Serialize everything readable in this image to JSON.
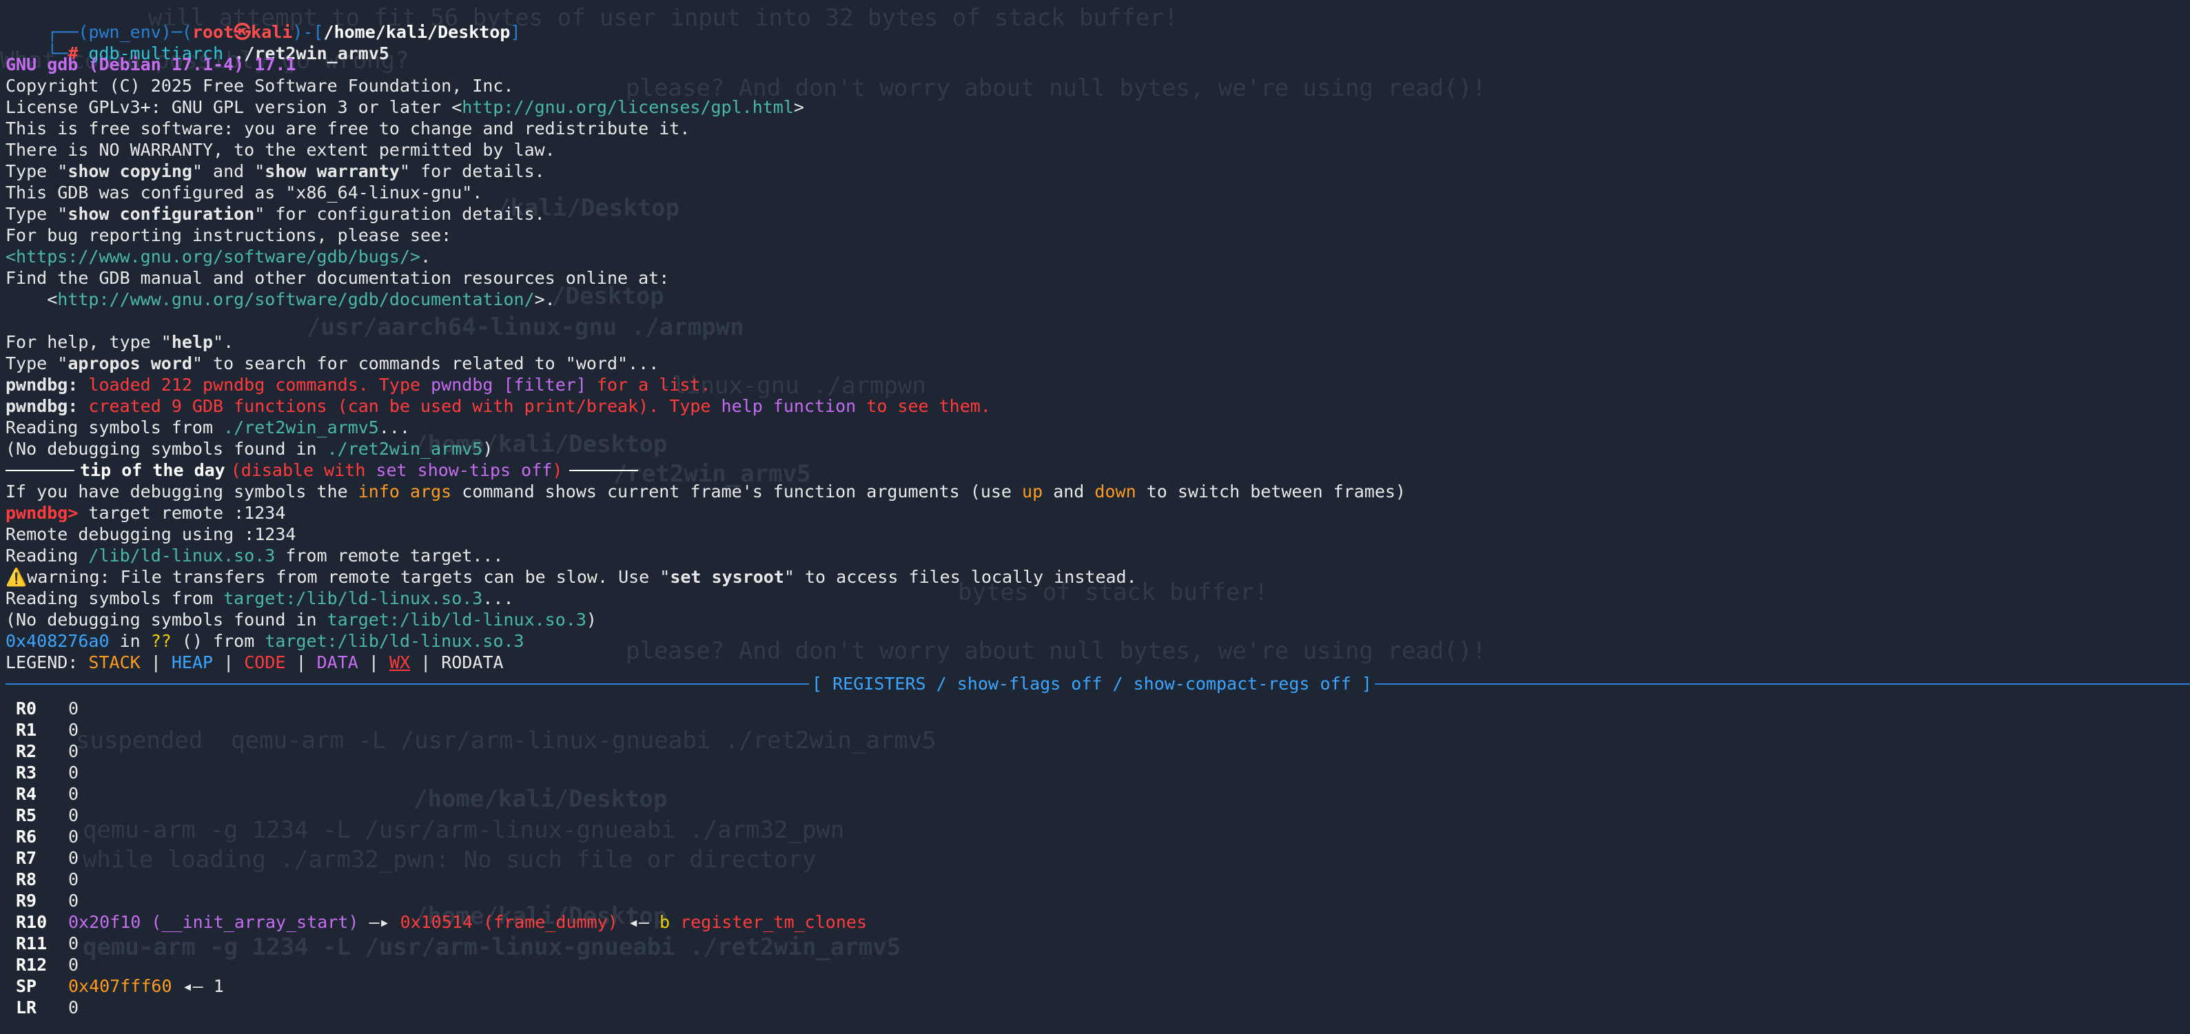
{
  "terminal": {
    "prompt": {
      "frame_open": "┌──(",
      "env": "pwn_env",
      "frame_mid": ")─(",
      "user": "root㉿kali",
      "frame_mid2": ")-[",
      "path": "/home/kali/Desktop",
      "frame_close": "]",
      "line2_frame": "└─",
      "hash": "#",
      "command_name": "gdb-multiarch",
      "command_args": " ./ret2win_armv5"
    },
    "banner": {
      "gdb_version": "GNU gdb (Debian 17.1-4) 17.1",
      "copyright": "Copyright (C) 2025 Free Software Foundation, Inc.",
      "license_prefix": "License GPLv3+: GNU GPL version 3 or later <",
      "license_url": "http://gnu.org/licenses/gpl.html",
      "license_suffix": ">",
      "free_software": "This is free software: you are free to change and redistribute it.",
      "no_warranty": "There is NO WARRANTY, to the extent permitted by law.",
      "type_prefix": "Type \"",
      "show_copying": "show copying",
      "and_mid": "\" and \"",
      "show_warranty": "show warranty",
      "details_suffix": "\" for details.",
      "configured": "This GDB was configured as \"x86_64-linux-gnu\".",
      "show_configuration": "show configuration",
      "config_suffix": "\" for configuration details.",
      "bug_reporting": "For bug reporting instructions, please see:",
      "bug_url": "<https://www.gnu.org/software/gdb/bugs/>",
      "bug_suffix": ".",
      "manual": "Find the GDB manual and other documentation resources online at:",
      "doc_prefix": "    <",
      "doc_url": "http://www.gnu.org/software/gdb/documentation/",
      "doc_suffix": ">.",
      "help_prefix": "For help, type \"",
      "help": "help",
      "help_suffix": "\".",
      "apropos_prefix": "Type \"",
      "apropos": "apropos word",
      "apropos_suffix": "\" to search for commands related to \"word\"..."
    },
    "pwndbg": {
      "label": "pwndbg:",
      "loaded_prefix": " loaded 212 pwndbg commands. Type ",
      "loaded_cmd": "pwndbg [filter]",
      "loaded_suffix": " for a list.",
      "created_prefix": " created 9 GDB functions (can be used with print/break). Type ",
      "created_cmd": "help function",
      "created_suffix": " to see them."
    },
    "symbols": {
      "reading_prefix": "Reading symbols from ",
      "reading_file": "./ret2win_armv5",
      "reading_suffix": "...",
      "nodebug_prefix": "(No debugging symbols found in ",
      "nodebug_file": "./ret2win_armv5",
      "nodebug_suffix": ")"
    },
    "tip": {
      "title": "tip of the day",
      "disable_prefix": "(disable with ",
      "disable_cmd": "set show-tips off",
      "disable_suffix": ")",
      "text_prefix": "If you have debugging symbols the ",
      "text_cmd": "info args",
      "text_mid": " command shows current frame's function arguments (use ",
      "text_up": "up",
      "text_and": " and ",
      "text_down": "down",
      "text_suffix": " to switch between frames)"
    },
    "session": {
      "prompt": "pwndbg>",
      "command": " target remote :1234",
      "remote_debugging": "Remote debugging using :1234",
      "reading_prefix": "Reading ",
      "reading_file": "/lib/ld-linux.so.3",
      "reading_suffix": " from remote target...",
      "warn_icon": "⚠️",
      "warning_prefix": "warning: File transfers from remote targets can be slow. Use \"",
      "warning_cmd": "set sysroot",
      "warning_suffix": "\" to access files locally instead.",
      "symbols_prefix": "Reading symbols from ",
      "symbols_file": "target:/lib/ld-linux.so.3",
      "symbols_suffix": "...",
      "nodebug_prefix": "(No debugging symbols found in ",
      "nodebug_file": "target:/lib/ld-linux.so.3",
      "nodebug_suffix": ")",
      "stop_addr": "0x408276a0",
      "stop_in": " in ",
      "stop_func": "??",
      "stop_from": " () from ",
      "stop_file": "target:/lib/ld-linux.so.3"
    },
    "legend": {
      "label": "LEGEND: ",
      "stack": "STACK",
      "heap": "HEAP",
      "code": "CODE",
      "data": "DATA",
      "wx": "WX",
      "rodata": "RODATA",
      "sep": " | "
    },
    "registers_header": "[ REGISTERS / show-flags off / show-compact-regs off ]",
    "registers": [
      {
        "name": "R0",
        "value": "0"
      },
      {
        "name": "R1",
        "value": "0"
      },
      {
        "name": "R2",
        "value": "0"
      },
      {
        "name": "R3",
        "value": "0"
      },
      {
        "name": "R4",
        "value": "0"
      },
      {
        "name": "R5",
        "value": "0"
      },
      {
        "name": "R6",
        "value": "0"
      },
      {
        "name": "R7",
        "value": "0"
      },
      {
        "name": "R8",
        "value": "0"
      },
      {
        "name": "R9",
        "value": "0"
      },
      {
        "name": "R10",
        "value": "0x20f10 (__init_array_start)",
        "arrow1": " —▸ ",
        "value2": "0x10514 (frame_dummy)",
        "arrow2": " ◂— ",
        "value3": "b",
        "value4": " register_tm_clones"
      },
      {
        "name": "R11",
        "value": "0"
      },
      {
        "name": "R12",
        "value": "0"
      },
      {
        "name": "SP",
        "value": "0x407fff60",
        "arrow2": " ◂— ",
        "value3": "1"
      },
      {
        "name": "LR",
        "value": "0"
      }
    ]
  },
  "background_ghost": [
    "will attempt to fit 56 bytes of user input into 32 bytes of stack buffer!",
    "What could possibly go wrong?",
    "please? And don't worry about null bytes, we're using read()!",
    "/kali/Desktop",
    "/Desktop",
    "/usr/aarch64-linux-gnu ./armpwn",
    "-linux-gnu ./armpwn",
    "/home/kali/Desktop",
    "/ret2win_armv5",
    "bytes of stack buffer!",
    "please? And don't worry about null bytes, we're using read()!",
    "suspended  qemu-arm -L /usr/arm-linux-gnueabi ./ret2win_armv5",
    "/home/kali/Desktop",
    "qemu-arm -g 1234 -L /usr/arm-linux-gnueabi ./arm32_pwn",
    "while loading ./arm32_pwn: No such file or directory",
    "/home/kali/Desktop",
    "qemu-arm -g 1234 -L /usr/arm-linux-gnueabi ./ret2win_armv5"
  ],
  "colors": {
    "background": "#1e2633",
    "prompt_frame": "#2a7fd4",
    "root": "#ff4d4d",
    "banner": "#c66cf0",
    "url": "#4ab8a8",
    "error_red": "#ff3b3b",
    "orange": "#ff9a1f",
    "blue": "#3ba6ff"
  }
}
